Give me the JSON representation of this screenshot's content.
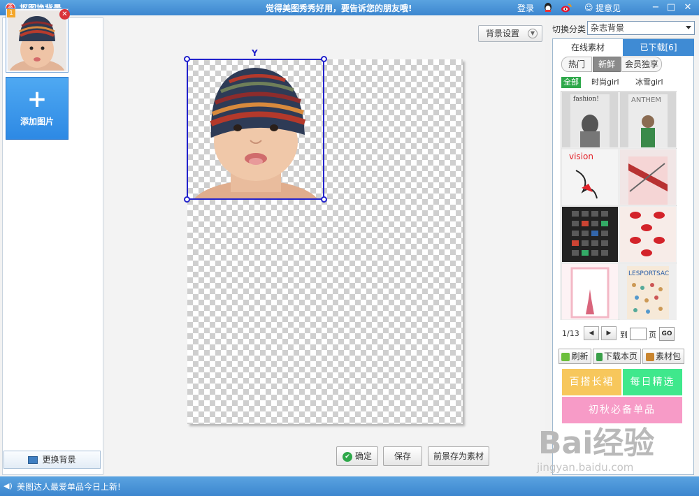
{
  "window": {
    "title": "抠图换背景",
    "slogan": "觉得美图秀秀好用，要告诉您的朋友哦!",
    "login": "登录",
    "feedback": "提意见",
    "logo_glyph": "秀"
  },
  "left_panel": {
    "thumb_badge": "1",
    "add_image_label": "添加图片",
    "add_image_glyph": "+",
    "change_bg_label": "更换背景"
  },
  "toolbar": {
    "bg_settings": "背景设置"
  },
  "actions": {
    "confirm": "确定",
    "save": "保存",
    "save_foreground": "前景存为素材"
  },
  "right_panel": {
    "category_label": "切换分类",
    "category_value": "杂志背景",
    "tabs": [
      "在线素材",
      "已下载[6]"
    ],
    "segments": [
      "热门",
      "新鲜",
      "会员独享"
    ],
    "active_segment": "新鲜",
    "subfilters": [
      "全部",
      "时尚girl",
      "冰雪girl"
    ],
    "pager": {
      "page": "1/13",
      "goto": "到",
      "unit": "页",
      "go": "GO"
    },
    "buttons": [
      "刷新",
      "下载本页",
      "素材包"
    ],
    "promos": [
      "百搭长裙",
      "每日精选",
      "初秋必备单品"
    ],
    "thumb_texts": [
      "fashion!",
      "ANTHEM",
      "vision",
      "",
      "",
      "",
      "",
      "LESPORTSAC"
    ]
  },
  "status": {
    "text": "美图达人最爱单品今日上新!"
  },
  "watermark": {
    "main": "Bai经验",
    "sub": "jingyan.baidu.com"
  },
  "colors": {
    "titlebar": "#3c86cf",
    "selection": "#2222cc",
    "active_green": "#2ea84a"
  }
}
